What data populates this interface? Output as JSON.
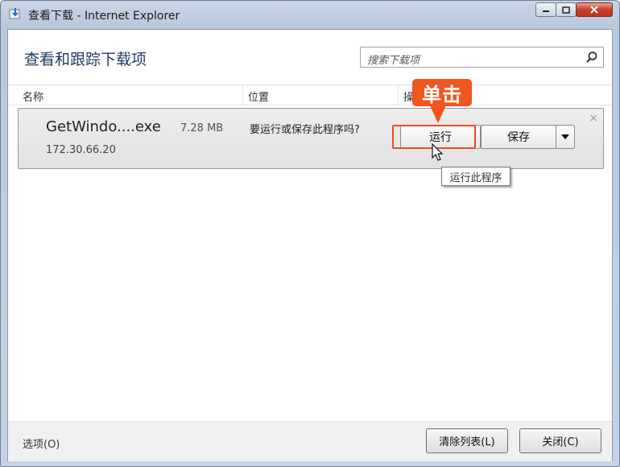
{
  "window": {
    "title": "查看下载 - Internet Explorer"
  },
  "header": {
    "title": "查看和跟踪下载项",
    "search_placeholder": "搜索下载项"
  },
  "columns": [
    "名称",
    "位置",
    "操"
  ],
  "download": {
    "file_name": "GetWindo....exe",
    "file_size": "7.28 MB",
    "source_host": "172.30.66.20",
    "prompt": "要运行或保存此程序吗?",
    "run_label": "运行",
    "save_label": "保存",
    "dismiss": "×"
  },
  "annotation": {
    "callout_text": "单击",
    "tooltip": "运行此程序"
  },
  "footer": {
    "options_label": "选项(O)",
    "clear_label": "清除列表(L)",
    "close_label": "关闭(C)"
  },
  "colors": {
    "callout": "#f0561f",
    "highlight_border": "#ee4a24",
    "close_button": "#c7402a"
  }
}
